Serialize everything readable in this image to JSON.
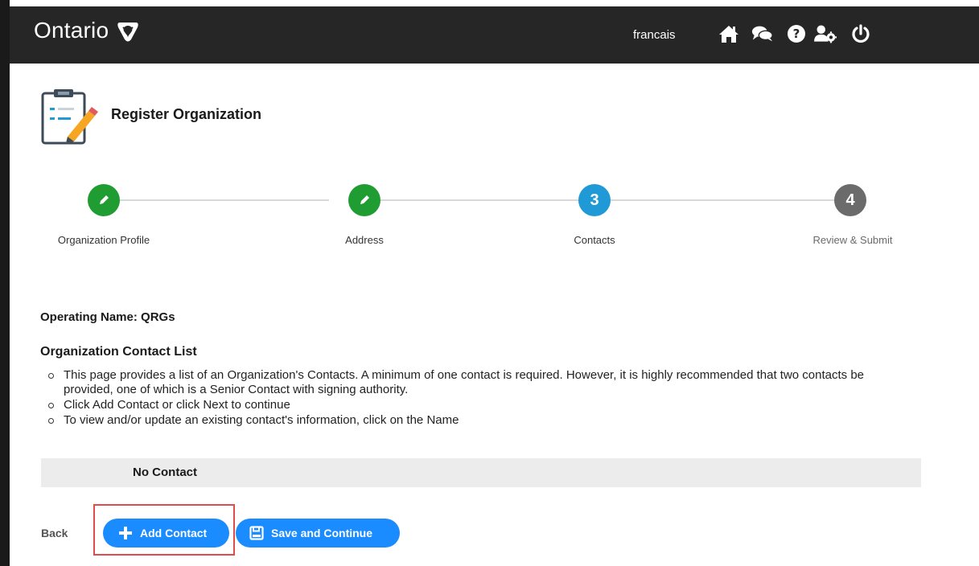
{
  "header": {
    "brand": "Ontario",
    "language_link": "francais",
    "icons": [
      "home-icon",
      "chat-icon",
      "help-icon",
      "user-settings-icon",
      "power-icon"
    ]
  },
  "page": {
    "title": "Register Organization",
    "icon": "clipboard-pencil-icon"
  },
  "stepper": {
    "steps": [
      {
        "label": "Organization Profile",
        "state": "completed",
        "marker": "pencil-icon"
      },
      {
        "label": "Address",
        "state": "completed",
        "marker": "pencil-icon"
      },
      {
        "label": "Contacts",
        "state": "current",
        "marker": "3"
      },
      {
        "label": "Review & Submit",
        "state": "pending",
        "marker": "4"
      }
    ]
  },
  "operating_name": "Operating Name: QRGs",
  "contact_list": {
    "title": "Organization Contact List",
    "instructions": [
      "This page provides a list of an Organization's Contacts. A minimum of one contact is required. However, it is highly recommended that two contacts be provided, one of which is a Senior Contact with signing authority.",
      "Click Add Contact or click Next to continue",
      "To view and/or update an existing contact's information, click on the Name"
    ],
    "empty_text": "No Contact"
  },
  "actions": {
    "back_label": "Back",
    "add_contact_label": "Add Contact",
    "save_continue_label": "Save and Continue"
  },
  "colors": {
    "header_bg": "#262626",
    "step_completed": "#1f9d32",
    "step_current": "#1f9ad6",
    "step_pending": "#6b6b6b",
    "button_primary": "#1a8cff",
    "highlight_border": "#e04b4b",
    "table_bg": "#ececec"
  }
}
